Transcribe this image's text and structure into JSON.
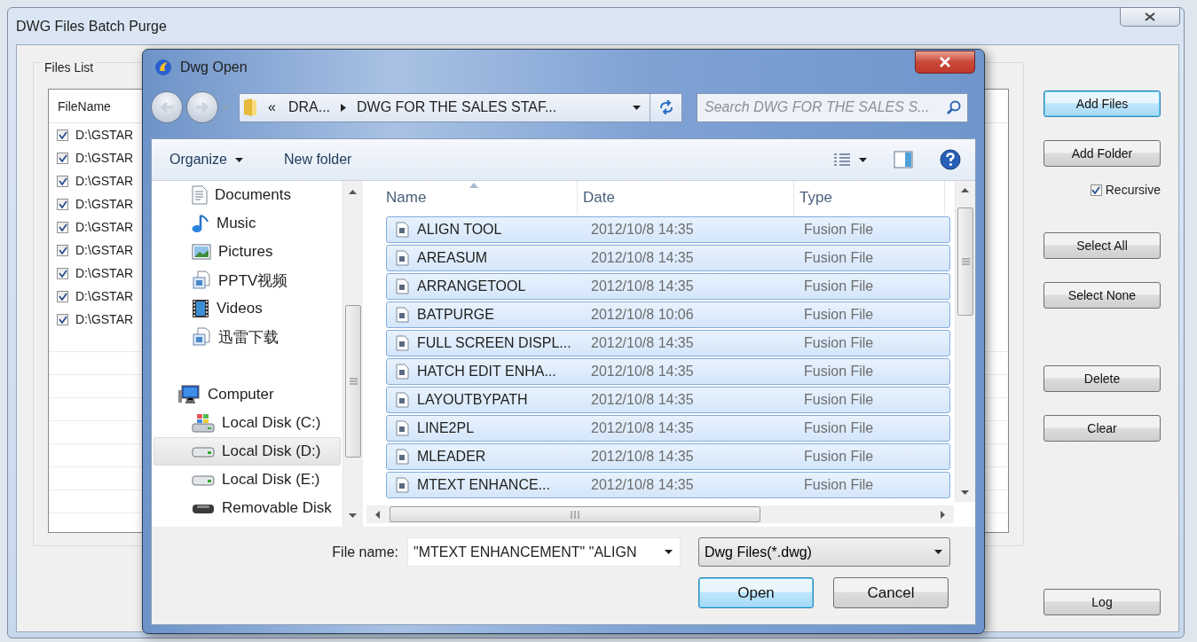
{
  "window": {
    "title": "DWG Files Batch Purge"
  },
  "files_list": {
    "title": "Files List",
    "columns": [
      "FileName"
    ],
    "rows": [
      {
        "name": "D:\\GSTAR",
        "checked": true
      },
      {
        "name": "D:\\GSTAR",
        "checked": true
      },
      {
        "name": "D:\\GSTAR",
        "checked": true
      },
      {
        "name": "D:\\GSTAR",
        "checked": true
      },
      {
        "name": "D:\\GSTAR",
        "checked": true
      },
      {
        "name": "D:\\GSTAR",
        "checked": true
      },
      {
        "name": "D:\\GSTAR",
        "checked": true
      },
      {
        "name": "D:\\GSTAR",
        "checked": true
      },
      {
        "name": "D:\\GSTAR",
        "checked": true
      }
    ]
  },
  "side_panel": {
    "groups": [
      {
        "items": [
          {
            "kind": "button",
            "label": "Add Files",
            "default": true
          },
          {
            "kind": "button",
            "label": "Add Folder",
            "default": false
          },
          {
            "kind": "checkbox",
            "label": "Recursive",
            "checked": true
          }
        ]
      },
      {
        "items": [
          {
            "kind": "button",
            "label": "Select All",
            "default": false
          },
          {
            "kind": "button",
            "label": "Select None",
            "default": false
          }
        ]
      },
      {
        "items": [
          {
            "kind": "button",
            "label": "Delete",
            "default": false
          },
          {
            "kind": "button",
            "label": "Clear",
            "default": false
          }
        ]
      },
      {
        "items": [
          {
            "kind": "button",
            "label": "Log",
            "default": false
          }
        ]
      }
    ]
  },
  "dialog": {
    "title": "Dwg Open",
    "address": {
      "overflow": "«",
      "path": [
        "DRA...",
        "DWG FOR THE SALES STAF..."
      ]
    },
    "search": {
      "placeholder": "Search DWG FOR THE SALES S..."
    },
    "toolbar": [
      {
        "label": "Organize",
        "menu": true
      },
      {
        "label": "New folder",
        "menu": false
      }
    ],
    "nav_pane": {
      "sections": [
        {
          "items": [
            {
              "label": "Documents",
              "kind": "documents",
              "selected": false
            },
            {
              "label": "Music",
              "kind": "music",
              "selected": false
            },
            {
              "label": "Pictures",
              "kind": "pictures",
              "selected": false
            },
            {
              "label": "PPTV视频",
              "kind": "library",
              "selected": false
            },
            {
              "label": "Videos",
              "kind": "videos",
              "selected": false
            },
            {
              "label": "迅雷下载",
              "kind": "library",
              "selected": false
            }
          ]
        },
        {
          "label": "Computer",
          "kind": "computer",
          "selected": false,
          "children": [
            {
              "label": "Local Disk (C:)",
              "kind": "system-drive",
              "selected": false
            },
            {
              "label": "Local Disk (D:)",
              "kind": "drive",
              "selected": true
            },
            {
              "label": "Local Disk (E:)",
              "kind": "drive",
              "selected": false
            },
            {
              "label": "Removable Disk",
              "kind": "removable",
              "selected": false
            }
          ]
        }
      ]
    },
    "files": {
      "columns": [
        "Name",
        "Date",
        "Type"
      ],
      "rows": [
        {
          "name": "ALIGN TOOL",
          "date": "2012/10/8 14:35",
          "type": "Fusion File",
          "selected": true
        },
        {
          "name": "AREASUM",
          "date": "2012/10/8 14:35",
          "type": "Fusion File",
          "selected": true
        },
        {
          "name": "ARRANGETOOL",
          "date": "2012/10/8 14:35",
          "type": "Fusion File",
          "selected": true
        },
        {
          "name": "BATPURGE",
          "date": "2012/10/8 10:06",
          "type": "Fusion File",
          "selected": true
        },
        {
          "name": "FULL SCREEN DISPL...",
          "date": "2012/10/8 14:35",
          "type": "Fusion File",
          "selected": true
        },
        {
          "name": "HATCH EDIT ENHA...",
          "date": "2012/10/8 14:35",
          "type": "Fusion File",
          "selected": true
        },
        {
          "name": "LAYOUTBYPATH",
          "date": "2012/10/8 14:35",
          "type": "Fusion File",
          "selected": true
        },
        {
          "name": "LINE2PL",
          "date": "2012/10/8 14:35",
          "type": "Fusion File",
          "selected": true
        },
        {
          "name": "MLEADER",
          "date": "2012/10/8 14:35",
          "type": "Fusion File",
          "selected": true
        },
        {
          "name": "MTEXT ENHANCE...",
          "date": "2012/10/8 14:35",
          "type": "Fusion File",
          "selected": true
        }
      ]
    },
    "file_name": {
      "label": "File name:",
      "value": "\"MTEXT ENHANCEMENT\" \"ALIGN"
    },
    "filter": "Dwg Files(*.dwg)",
    "buttons": [
      {
        "label": "Open",
        "default": true
      },
      {
        "label": "Cancel",
        "default": false
      }
    ]
  }
}
